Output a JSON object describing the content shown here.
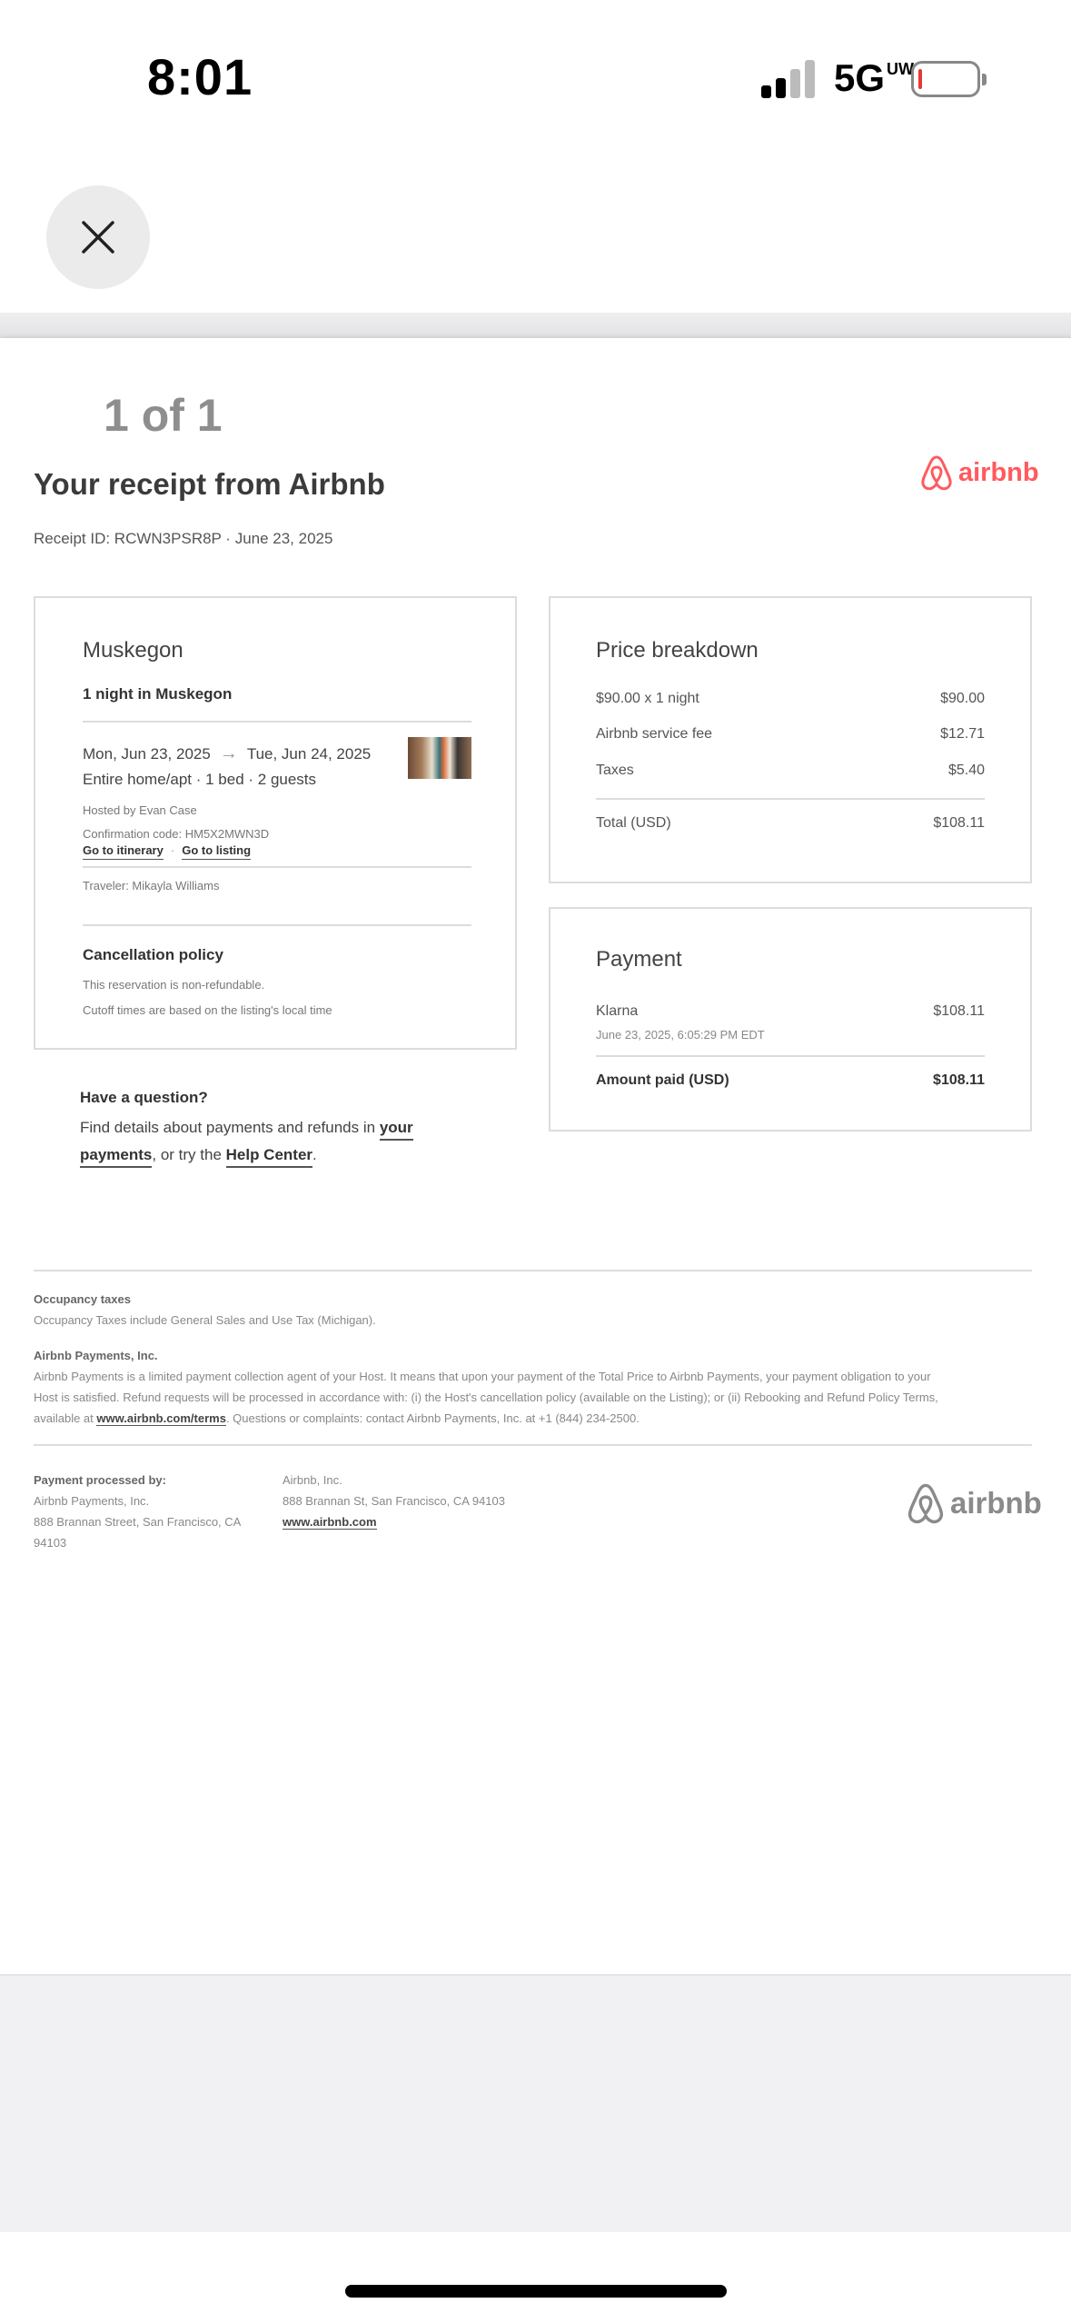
{
  "status_bar": {
    "time": "8:01",
    "network": "5G",
    "network_sup": "UW"
  },
  "header": {
    "page_count": "1 of 1",
    "title": "Your receipt from Airbnb",
    "receipt_id": "Receipt ID: RCWN3PSR8P · June 23, 2025",
    "logo_text": "airbnb"
  },
  "trip": {
    "city": "Muskegon",
    "nights": "1 night in Muskegon",
    "check_in": "Mon, Jun 23, 2025",
    "check_out": "Tue, Jun 24, 2025",
    "home_desc": "Entire home/apt · 1 bed · 2 guests",
    "hosted_by": "Hosted by Evan Case",
    "confirmation": "Confirmation code: HM5X2MWN3D",
    "itinerary_link": "Go to itinerary",
    "listing_link": "Go to listing",
    "traveler": "Traveler: Mikayla Williams",
    "cancellation_heading": "Cancellation policy",
    "cancellation_line1": "This reservation is non-refundable.",
    "cancellation_line2": "Cutoff times are based on the listing's local time"
  },
  "price": {
    "title": "Price breakdown",
    "rows": [
      {
        "label": "$90.00 x 1 night",
        "value": "$90.00"
      },
      {
        "label": "Airbnb service fee",
        "value": "$12.71"
      },
      {
        "label": "Taxes",
        "value": "$5.40"
      }
    ],
    "total_label": "Total (USD)",
    "total_value": "$108.11"
  },
  "payment": {
    "title": "Payment",
    "method": "Klarna",
    "amount": "$108.11",
    "date": "June 23, 2025, 6:05:29 PM EDT",
    "paid_label": "Amount paid (USD)",
    "paid_value": "$108.11"
  },
  "question": {
    "heading": "Have a question?",
    "text_before": "Find details about payments and refunds in ",
    "your": "your",
    "payments": "payments",
    "text_middle": ", or try the ",
    "help_center": "Help Center",
    "text_end": "."
  },
  "footer": {
    "occupancy_heading": "Occupancy taxes",
    "occupancy_text": "Occupancy Taxes include General Sales and Use Tax (Michigan).",
    "payments_heading": "Airbnb Payments, Inc.",
    "payments_text_1": "Airbnb Payments is a limited payment collection agent of your Host. It means that upon your payment of the Total Price to Airbnb Payments, your payment obligation to your",
    "payments_text_2": "Host is satisfied. Refund requests will be processed in accordance with: (i) the Host's cancellation policy (available on the Listing); or (ii) Rebooking and Refund Policy Terms,",
    "payments_text_3a": "available at ",
    "terms_link": "www.airbnb.com/terms",
    "payments_text_3b": ". Questions or complaints: contact Airbnb Payments, Inc. at +1 (844) 234-2500.",
    "processed_heading": "Payment processed by:",
    "processed_name": "Airbnb Payments, Inc.",
    "processed_addr1": "888 Brannan Street, San Francisco, CA",
    "processed_addr2": "94103",
    "inc_name": "Airbnb, Inc.",
    "inc_addr": "888 Brannan St, San Francisco, CA 94103",
    "inc_link": "www.airbnb.com",
    "logo_text": "airbnb"
  },
  "colors": {
    "brand": "#ff5a5f",
    "logo_gray": "#8a8a8a"
  }
}
